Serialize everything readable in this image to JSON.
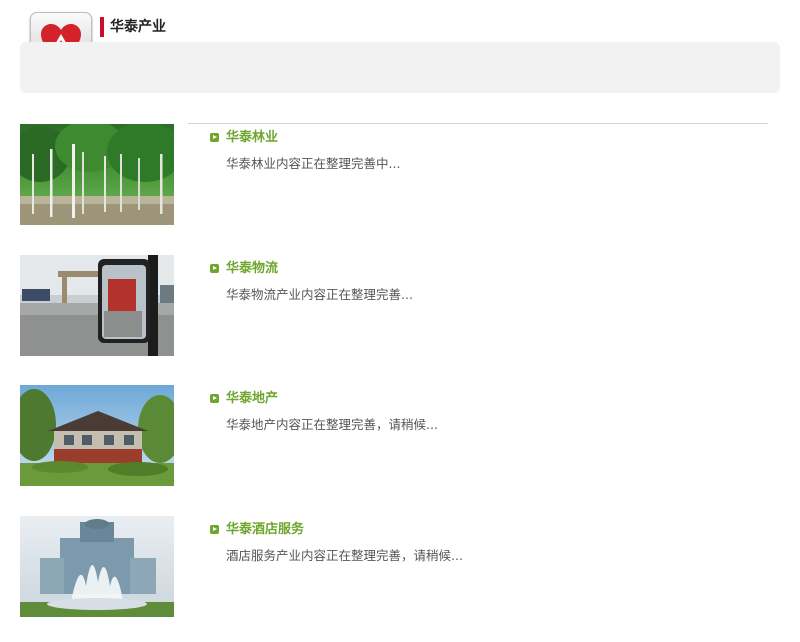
{
  "header": {
    "title": "华泰产业",
    "logo_icon": "heart-logo-icon"
  },
  "colors": {
    "accent_red": "#c8102e",
    "title_green": "#6fa62d",
    "text_gray": "#555555"
  },
  "items": [
    {
      "title": "华泰林业",
      "desc": "华泰林业内容正在整理完善中...",
      "image": "forest-photo"
    },
    {
      "title": "华泰物流",
      "desc": "华泰物流产业内容正在整理完善...",
      "image": "truck-mirror-photo"
    },
    {
      "title": "华泰地产",
      "desc": "华泰地产内容正在整理完善，请稍候...",
      "image": "villa-photo"
    },
    {
      "title": "华泰酒店服务",
      "desc": "酒店服务产业内容正在整理完善，请稍候...",
      "image": "hotel-fountain-photo"
    }
  ]
}
